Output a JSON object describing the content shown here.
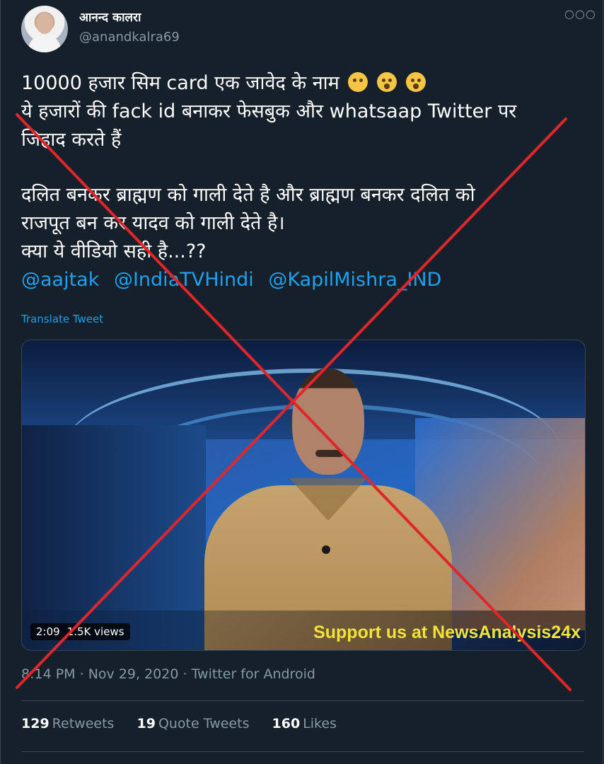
{
  "author": {
    "display_name": "आनन्द कालरा",
    "handle": "@anandkalra69"
  },
  "more_icon": "more-horizontal-icon",
  "tweet": {
    "lines": [
      "10000 हजार सिम card एक जावेद के नाम",
      "ये हजारों की fack id बनाकर फेसबुक और whatsaap Twitter पर",
      "जिहाद करते हैं",
      "दलित बनकर ब्राह्मण को गाली देते है और ब्राह्मण बनकर दलित को",
      "राजपूत बन कर यादव को गाली देते है।",
      "क्या ये वीडियो सही है...??"
    ],
    "emoji_icons": [
      "face-with-rolling-eyes-icon",
      "astonished-face-icon",
      "astonished-face-icon"
    ],
    "mentions": [
      "@aajtak",
      "@IndiaTVHindi",
      "@KapilMishra_IND"
    ],
    "translate_label": "Translate Tweet"
  },
  "video": {
    "duration": "2:09",
    "views": "1.5K views",
    "overlay_text": "Support us at NewsAnalysis24x"
  },
  "meta": {
    "time": "8:14 PM",
    "date": "Nov 29, 2020",
    "source": "Twitter for Android",
    "separator": "·"
  },
  "stats": {
    "retweets_count": "129",
    "retweets_label": "Retweets",
    "quotes_count": "19",
    "quotes_label": "Quote Tweets",
    "likes_count": "160",
    "likes_label": "Likes"
  },
  "colors": {
    "background": "#15202b",
    "link": "#1da1f2",
    "muted": "#8899a6",
    "cross_mark": "#e0262a"
  }
}
